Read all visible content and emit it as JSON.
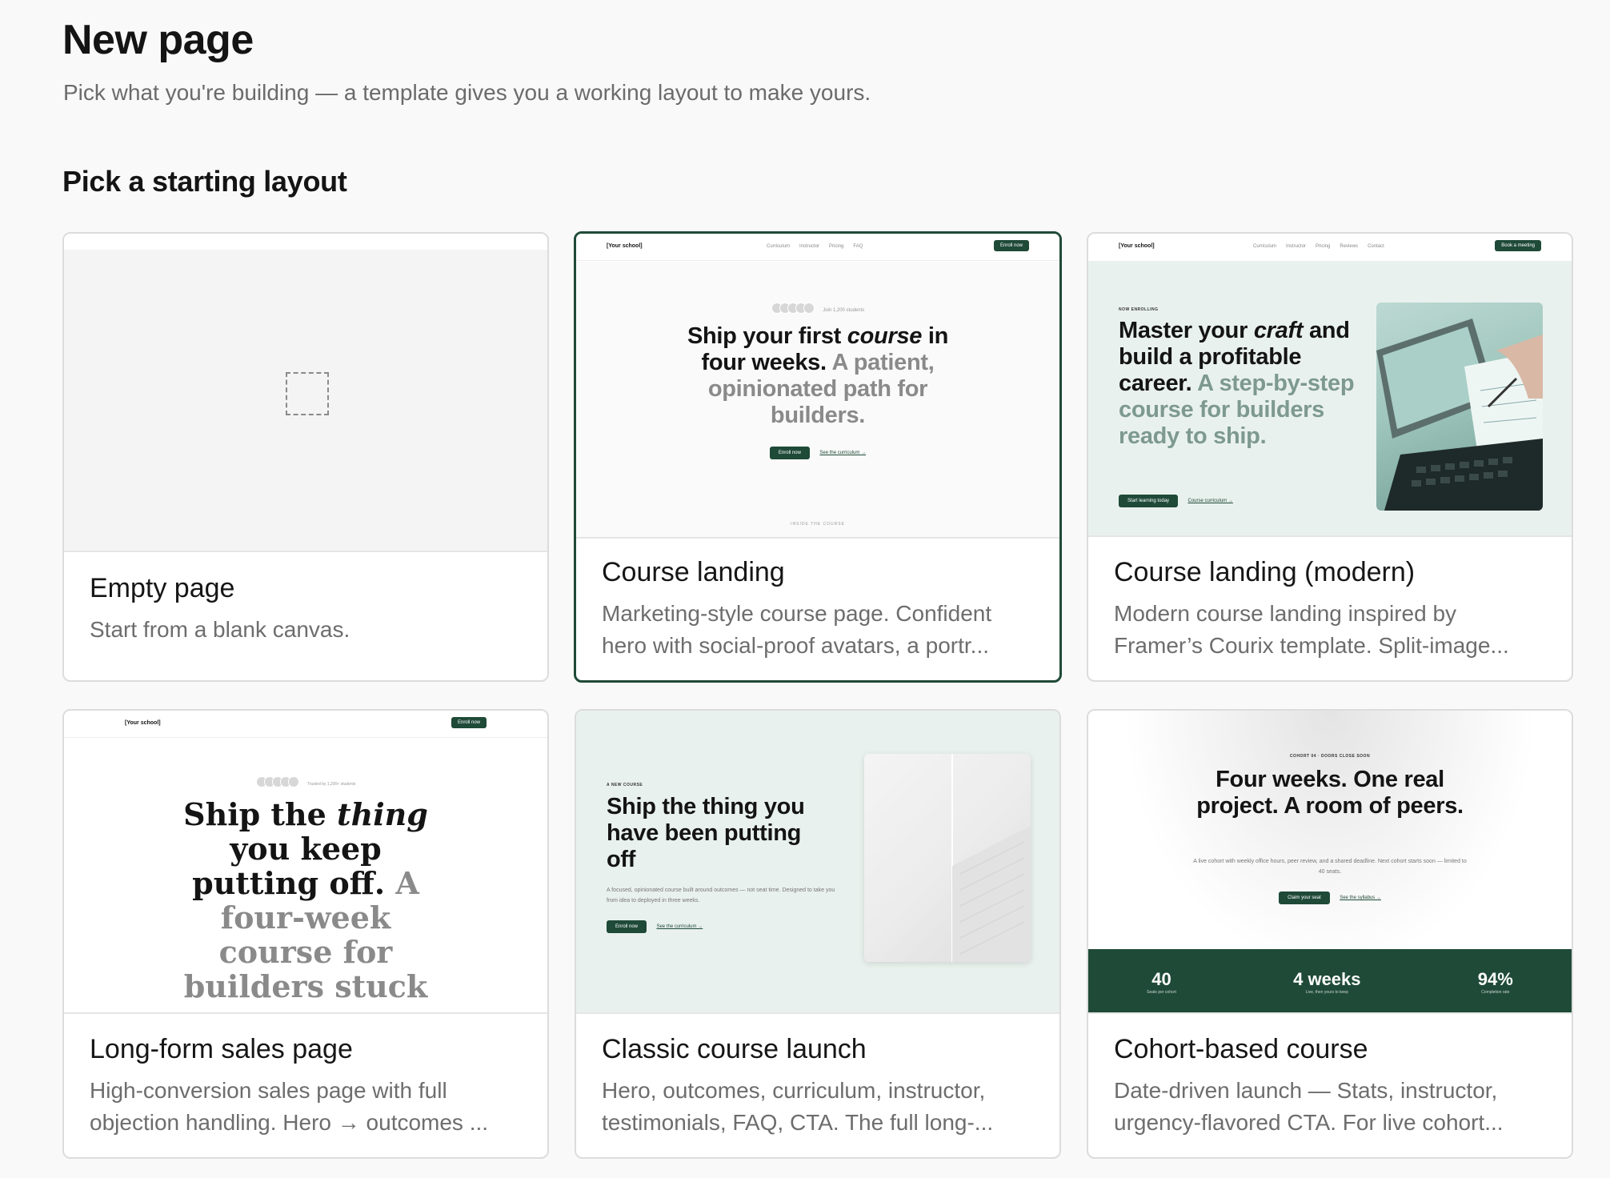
{
  "page": {
    "title": "New page",
    "subtitle": "Pick what you're building — a template gives you a working layout to make yours.",
    "section_title": "Pick a starting layout"
  },
  "colors": {
    "accent": "#1f4a38",
    "selected_border": "#1f4a38",
    "preview_tint": "#e9f1ee"
  },
  "templates": [
    {
      "name": "Empty page",
      "description": "Start from a blank canvas."
    },
    {
      "name": "Course landing",
      "description": "Marketing-style course page. Confident hero with social-proof avatars, a portr...",
      "selected": true
    },
    {
      "name": "Course landing (modern)",
      "description": "Modern course landing inspired by Framer’s Courix template. Split-image..."
    },
    {
      "name": "Long-form sales page",
      "description": "High-conversion sales page with full objection handling. Hero → outcomes ..."
    },
    {
      "name": "Classic course launch",
      "description": "Hero, outcomes, curriculum, instructor, testimonials, FAQ, CTA. The full long-..."
    },
    {
      "name": "Cohort-based course",
      "description": "Date-driven launch — Stats, instructor, urgency-flavored CTA. For live cohort..."
    }
  ],
  "previews": {
    "course_landing": {
      "logo": "[Your school]",
      "nav": [
        "Curriculum",
        "Instructor",
        "Pricing",
        "FAQ"
      ],
      "cta": "Enroll now",
      "proof": "Join 1,200 students",
      "headline_a": "Ship your first ",
      "headline_em": "course",
      "headline_b": " in four weeks.",
      "headline_muted": " A patient, opinionated path for builders.",
      "primary": "Enroll now",
      "secondary": "See the curriculum →",
      "footer_label": "INSIDE THE COURSE"
    },
    "course_modern": {
      "logo": "[Your school]",
      "nav": [
        "Curriculum",
        "Instructor",
        "Pricing",
        "Reviews",
        "Contact"
      ],
      "cta": "Book a meeting",
      "eyebrow": "NOW ENROLLING",
      "headline_a": "Master your ",
      "headline_em": "craft",
      "headline_b": " and build a profitable career.",
      "headline_muted": " A step-by-step course for builders ready to ship.",
      "primary": "Start learning today",
      "secondary": "Course curriculum →"
    },
    "long_form": {
      "logo": "[Your school]",
      "cta": "Enroll now",
      "proof": "Trusted by 1,200+ students",
      "headline_a": "Ship the ",
      "headline_em": "thing",
      "headline_b": " you keep putting off.",
      "headline_muted": " A four-week course for builders stuck"
    },
    "classic": {
      "eyebrow": "A NEW COURSE",
      "headline": "Ship the thing you have been putting off",
      "body": "A focused, opinionated course built around outcomes — not seat time. Designed to take you from idea to deployed in three weeks.",
      "primary": "Enroll now",
      "secondary": "See the curriculum →"
    },
    "cohort": {
      "eyebrow": "COHORT 04 · DOORS CLOSE SOON",
      "headline": "Four weeks. One real project. A room of peers.",
      "body": "A live cohort with weekly office hours, peer review, and a shared deadline. Next cohort starts soon — limited to 40 seats.",
      "primary": "Claim your seat",
      "secondary": "See the syllabus →",
      "stats": [
        {
          "value": "40",
          "label": "Seats per cohort"
        },
        {
          "value": "4 weeks",
          "label": "Live, then yours to keep"
        },
        {
          "value": "94%",
          "label": "Completion rate"
        }
      ]
    }
  }
}
